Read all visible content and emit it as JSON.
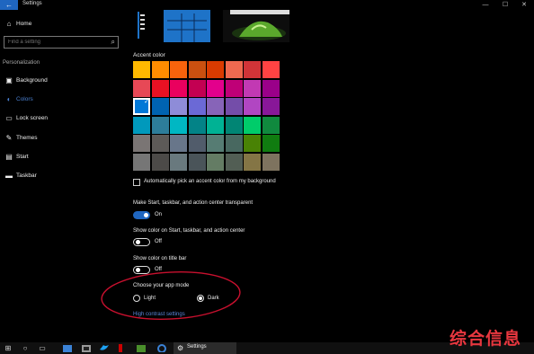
{
  "window": {
    "title": "Settings",
    "back_glyph": "←",
    "minimize": "—",
    "maximize": "☐",
    "close": "✕"
  },
  "sidebar": {
    "home_label": "Home",
    "search_placeholder": "Find a setting",
    "section_title": "Personalization",
    "items": [
      {
        "label": "Background",
        "icon": "picture-icon",
        "glyph": "▣",
        "active": false
      },
      {
        "label": "Colors",
        "icon": "palette-icon",
        "glyph": "◐",
        "active": true
      },
      {
        "label": "Lock screen",
        "icon": "lock-screen-icon",
        "glyph": "▭",
        "active": false
      },
      {
        "label": "Themes",
        "icon": "themes-icon",
        "glyph": "✎",
        "active": false
      },
      {
        "label": "Start",
        "icon": "start-icon",
        "glyph": "▤",
        "active": false
      },
      {
        "label": "Taskbar",
        "icon": "taskbar-icon",
        "glyph": "▬",
        "active": false
      }
    ]
  },
  "accent": {
    "title": "Accent color",
    "colors": [
      "#ffb900",
      "#ff8c00",
      "#f7630c",
      "#ca5010",
      "#da3b01",
      "#ef6950",
      "#d13438",
      "#ff4343",
      "#e74856",
      "#e81123",
      "#ea005e",
      "#c30052",
      "#e3008c",
      "#bf0077",
      "#c239b3",
      "#9a0089",
      "#0078d7",
      "#0063b1",
      "#8e8cd8",
      "#6b69d6",
      "#8764b8",
      "#744da9",
      "#b146c2",
      "#881798",
      "#0099bc",
      "#2d7d9a",
      "#00b7c3",
      "#038387",
      "#00b294",
      "#018574",
      "#00cc6a",
      "#10893e",
      "#7a7574",
      "#5d5a58",
      "#68768a",
      "#515c6b",
      "#567c73",
      "#486860",
      "#498205",
      "#107c10",
      "#767676",
      "#4c4a48",
      "#69797e",
      "#4a5459",
      "#647c64",
      "#525e54",
      "#847545",
      "#7e735f"
    ],
    "selected_index": 16,
    "check_glyph": "✓",
    "auto_pick_label": "Automatically pick an accent color from my background"
  },
  "settings": {
    "transparent_label": "Make Start, taskbar, and action center transparent",
    "transparent_state": "On",
    "start_color_label": "Show color on Start, taskbar, and action center",
    "start_color_state": "Off",
    "titlebar_color_label": "Show color on title bar",
    "titlebar_color_state": "Off",
    "app_mode_label": "Choose your app mode",
    "light_label": "Light",
    "dark_label": "Dark",
    "app_mode_selected": "Dark",
    "high_contrast_link": "High contrast settings"
  },
  "annotation": {
    "color": "#c8102e"
  },
  "taskbar": {
    "settings_label": "Settings",
    "start_glyph": "⊞",
    "search_glyph": "○",
    "taskview_glyph": "▭",
    "watermark": "综合信息"
  },
  "colors": {
    "accent_blue": "#1f66c0",
    "link_blue": "#5a86d8",
    "background": "#000000"
  }
}
